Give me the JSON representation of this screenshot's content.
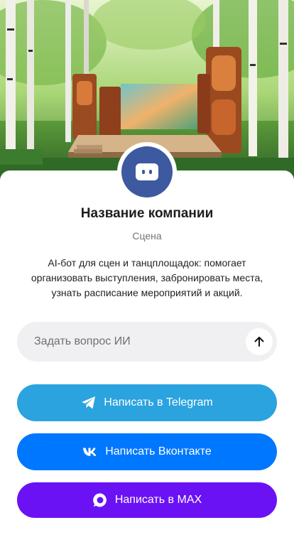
{
  "company": {
    "name": "Название компании",
    "category": "Сцена",
    "description": "AI-бот для сцен и танцплощадок: помогает организовать выступления, забронировать места, узнать расписание мероприятий и акций."
  },
  "ask": {
    "placeholder": "Задать вопрос ИИ",
    "value": ""
  },
  "buttons": {
    "telegram": "Написать в Telegram",
    "vk": "Написать Вконтакте",
    "max": "Написать в MAX"
  },
  "colors": {
    "avatar": "#3d5aa0",
    "telegram": "#2aa3df",
    "vk": "#0077ff",
    "max": "#6b12f5"
  },
  "icons": {
    "avatar": "chat-bot-icon",
    "send": "arrow-up-icon",
    "telegram": "telegram-icon",
    "vk": "vk-icon",
    "max": "max-icon"
  }
}
